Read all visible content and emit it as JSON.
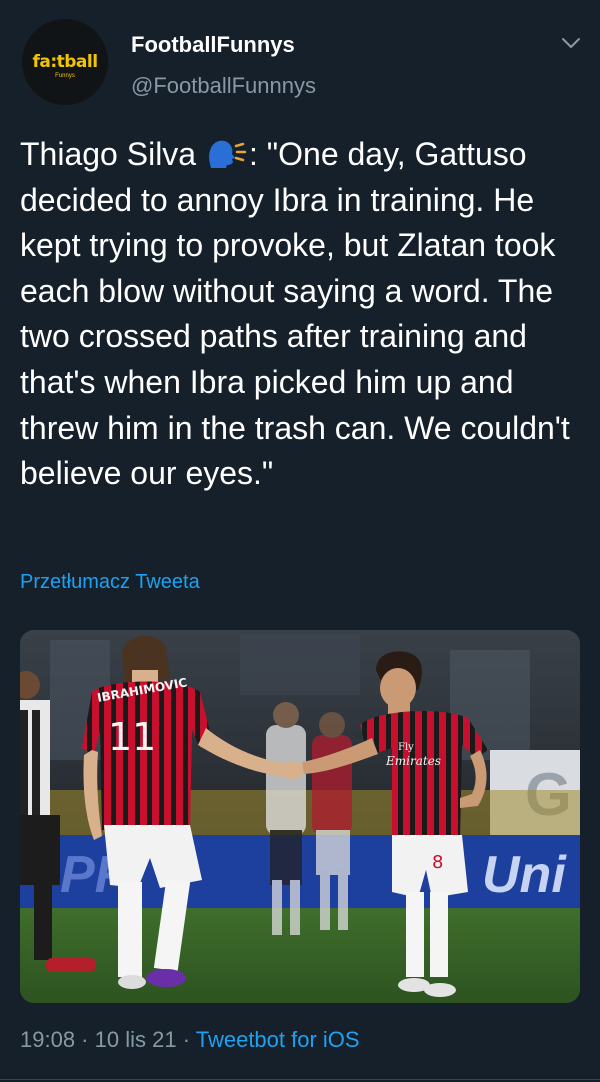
{
  "author": {
    "display_name": "FootballFunnys",
    "handle": "@FootballFunnnys",
    "avatar_text": "fa:tball",
    "avatar_subtext": "Funnys"
  },
  "tweet": {
    "text_before_emoji": "Thiago Silva ",
    "emoji": "speaking-head-icon",
    "text_after_emoji": ": \"One day, Gattuso decided to annoy Ibra in training. He kept trying to provoke, but Zlatan took each blow without saying a word. The two crossed paths after training and that's when Ibra picked him up and threw him in the trash can. We couldn't believe our eyes.\"",
    "translate_label": "Przetłumacz Tweeta"
  },
  "media": {
    "left_player_name": "IBRAHIMOVIC",
    "left_player_number": "11",
    "right_player_number": "8",
    "sponsor_line1": "Fly",
    "sponsor_line2": "Emirates",
    "banner_text_right": "Uni",
    "banner_text_left": "PR",
    "billboard_letter": "G"
  },
  "meta": {
    "time": "19:08",
    "separator": " · ",
    "date": "10 lis 21",
    "app": "Tweetbot for iOS"
  },
  "colors": {
    "background": "#15202b",
    "link": "#1da1f2",
    "secondary_text": "#8899a6",
    "avatar_logo": "#f2c500"
  }
}
